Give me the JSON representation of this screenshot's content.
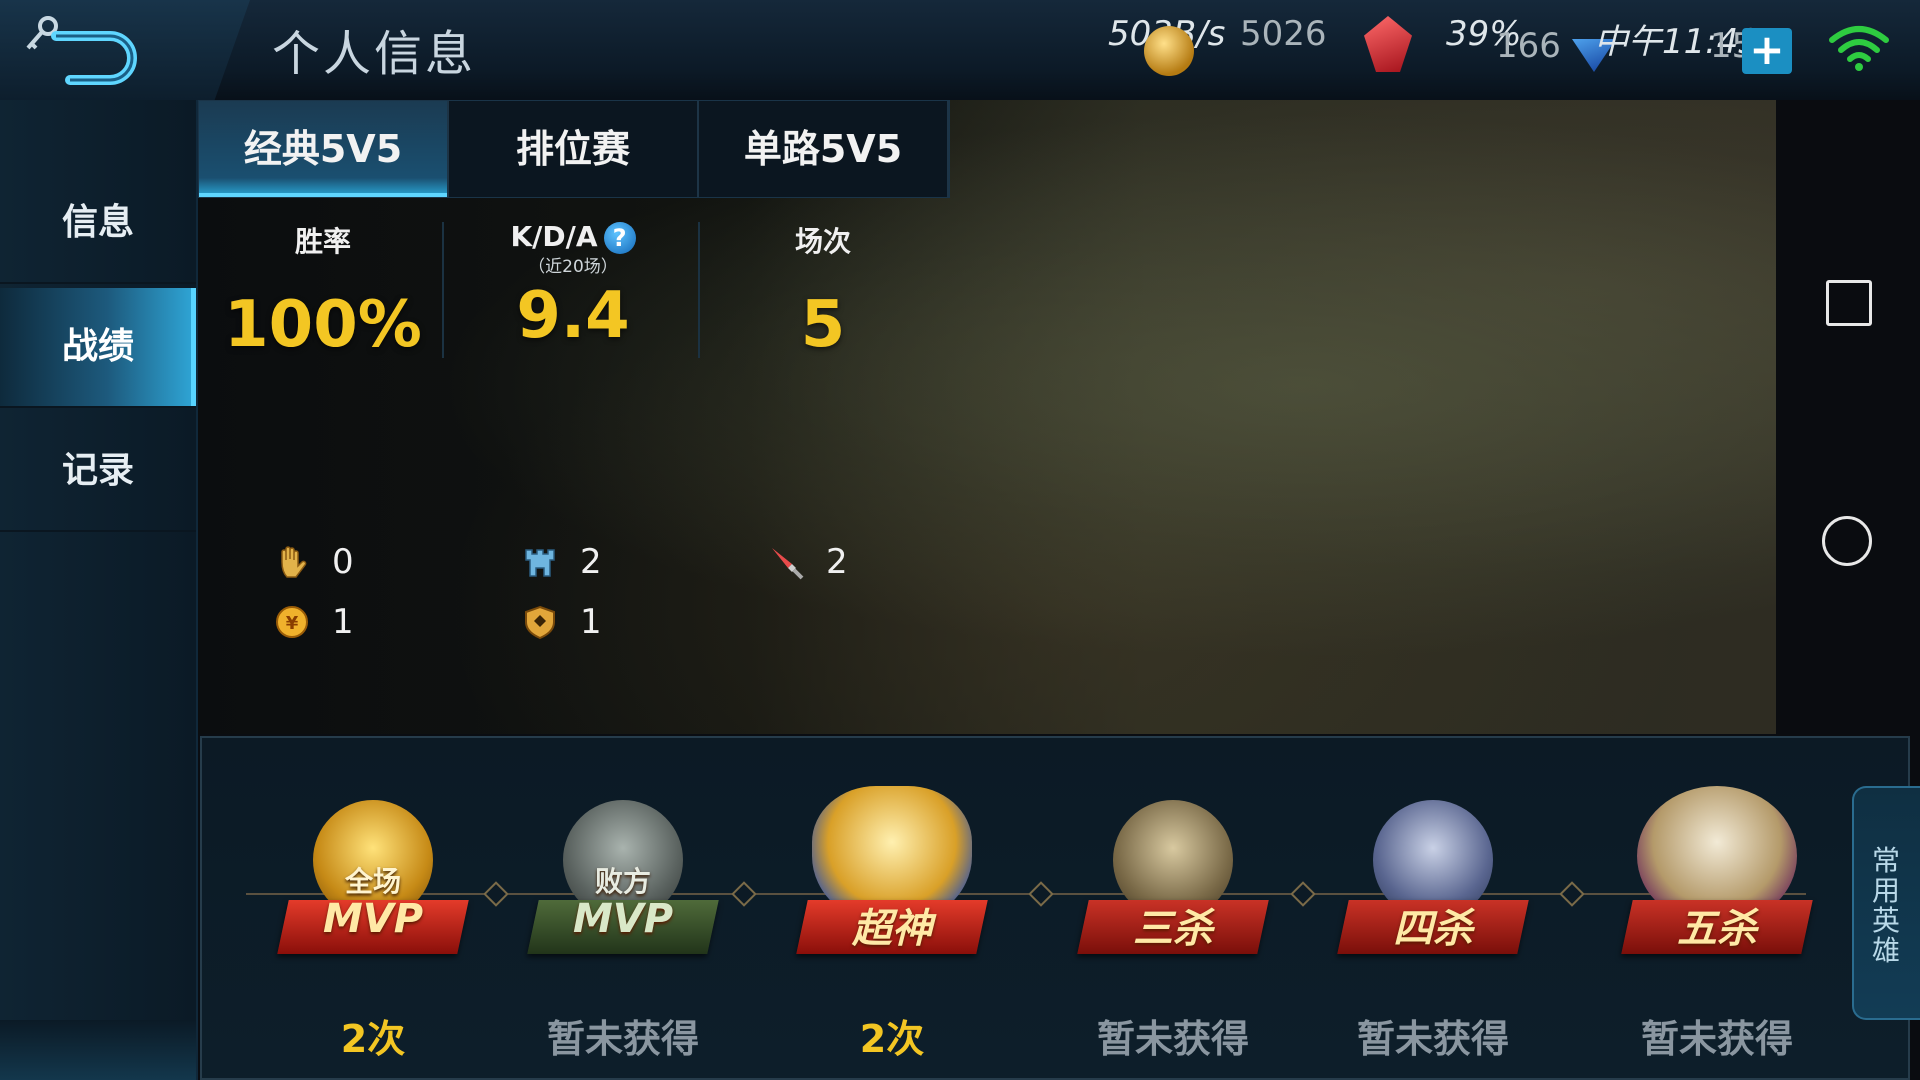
{
  "header": {
    "title": "个人信息",
    "status": {
      "net_speed": "503B/s",
      "coins": "5026",
      "gems": "166",
      "battery": "39%",
      "time": "中午11:43",
      "diamonds": "15",
      "plus": "+"
    }
  },
  "sidebar": {
    "items": [
      {
        "label": "信息"
      },
      {
        "label": "战绩"
      },
      {
        "label": "记录"
      }
    ]
  },
  "tabs": [
    {
      "label": "经典5V5"
    },
    {
      "label": "排位赛"
    },
    {
      "label": "单路5V5"
    }
  ],
  "stats": {
    "win_rate": {
      "label": "胜率",
      "value": "100%"
    },
    "kda": {
      "label": "K/D/A",
      "sub": "（近20场）",
      "value": "9.4",
      "help": "?"
    },
    "matches": {
      "label": "场次",
      "value": "5"
    }
  },
  "small_stats": [
    {
      "icon": "hand-icon",
      "value": "0"
    },
    {
      "icon": "tower-icon",
      "value": "2"
    },
    {
      "icon": "sword-icon",
      "value": "2"
    },
    {
      "icon": "gold-coin-icon",
      "value": "1"
    },
    {
      "icon": "shield-icon",
      "value": "1"
    }
  ],
  "achievements": [
    {
      "top": "全场",
      "label": "MVP",
      "count": "2次"
    },
    {
      "top": "败方",
      "label": "MVP",
      "count": "暂未获得"
    },
    {
      "top": "",
      "label": "超神",
      "count": "2次"
    },
    {
      "top": "",
      "label": "三杀",
      "count": "暂未获得"
    },
    {
      "top": "",
      "label": "四杀",
      "count": "暂未获得"
    },
    {
      "top": "",
      "label": "五杀",
      "count": "暂未获得"
    }
  ],
  "side_tab": {
    "label": "常用英雄"
  },
  "colors": {
    "accent": "#2aa9d9",
    "value_gold": "#f3c623",
    "gray_text": "#8a96a0"
  }
}
